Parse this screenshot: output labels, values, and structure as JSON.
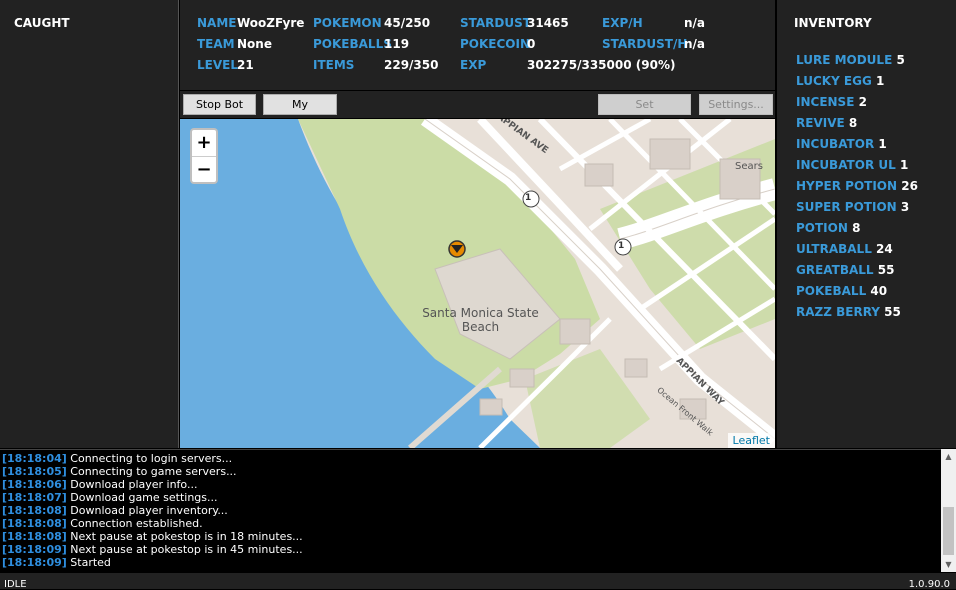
{
  "caught": {
    "header": "CAUGHT"
  },
  "stats": {
    "name_label": "NAME",
    "name_value": "WooZFyre",
    "team_label": "TEAM",
    "team_value": "None",
    "level_label": "LEVEL",
    "level_value": "21",
    "pokemon_label": "POKEMON",
    "pokemon_value": "45/250",
    "pokeballs_label": "POKEBALLS",
    "pokeballs_value": "119",
    "items_label": "ITEMS",
    "items_value": "229/350",
    "stardust_label": "STARDUST",
    "stardust_value": "31465",
    "pokecoin_label": "POKECOIN",
    "pokecoin_value": "0",
    "exp_label": "EXP",
    "exp_value": "302275/335000 (90%)",
    "exph_label": "EXP/H",
    "exph_value": "n/a",
    "stardusth_label": "STARDUST/H",
    "stardusth_value": "n/a"
  },
  "toolbar": {
    "stop_bot": "Stop Bot",
    "my_pokemon": "My Pokemon",
    "set_coordinates": "Set coordinates...",
    "settings": "Settings..."
  },
  "map": {
    "zoom_in": "+",
    "zoom_out": "−",
    "attribution": "Leaflet",
    "place_label_1": "Santa Monica State",
    "place_label_2": "Beach",
    "road_appian_ave": "APPIAN AVE",
    "road_appian_way": "APPIAN WAY",
    "road_ocean_front_walk": "Ocean Front Walk",
    "poi_sears": "Sears",
    "route_shield": "1",
    "colors": {
      "water": "#6aaee0",
      "park": "#cbdca6",
      "land": "#e8e0d8",
      "road": "#ffffff"
    }
  },
  "inventory": {
    "header": "INVENTORY",
    "items": [
      {
        "name": "LURE MODULE",
        "count": "5"
      },
      {
        "name": "LUCKY EGG",
        "count": "1"
      },
      {
        "name": "INCENSE",
        "count": "2"
      },
      {
        "name": "REVIVE",
        "count": "8"
      },
      {
        "name": "INCUBATOR",
        "count": "1"
      },
      {
        "name": "INCUBATOR UL",
        "count": "1"
      },
      {
        "name": "HYPER POTION",
        "count": "26"
      },
      {
        "name": "SUPER POTION",
        "count": "3"
      },
      {
        "name": "POTION",
        "count": "8"
      },
      {
        "name": "ULTRABALL",
        "count": "24"
      },
      {
        "name": "GREATBALL",
        "count": "55"
      },
      {
        "name": "POKEBALL",
        "count": "40"
      },
      {
        "name": "RAZZ BERRY",
        "count": "55"
      }
    ]
  },
  "log": [
    {
      "time": "[18:18:04]",
      "msg": "Connecting to login servers..."
    },
    {
      "time": "[18:18:05]",
      "msg": "Connecting to game servers..."
    },
    {
      "time": "[18:18:06]",
      "msg": "Download player info..."
    },
    {
      "time": "[18:18:07]",
      "msg": "Download game settings..."
    },
    {
      "time": "[18:18:08]",
      "msg": "Download player inventory..."
    },
    {
      "time": "[18:18:08]",
      "msg": "Connection established."
    },
    {
      "time": "[18:18:08]",
      "msg": "Next pause at pokestop is in 18 minutes..."
    },
    {
      "time": "[18:18:09]",
      "msg": "Next pause at pokestop is in 45 minutes..."
    },
    {
      "time": "[18:18:09]",
      "msg": "Started"
    }
  ],
  "status": {
    "state": "IDLE",
    "version": "1.0.90.0"
  },
  "colors": {
    "accent": "#3a9ad9",
    "panel": "#222222",
    "log_time": "#2f8fe0"
  }
}
